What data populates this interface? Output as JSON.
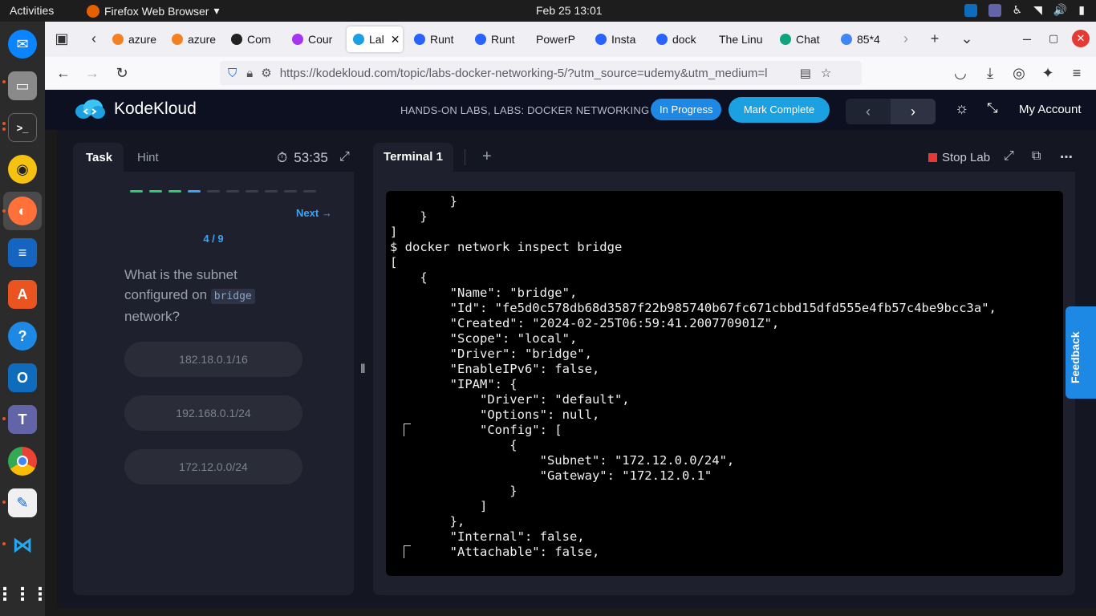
{
  "system": {
    "activities": "Activities",
    "app_name": "Firefox Web Browser",
    "clock": "Feb 25  13:01"
  },
  "browser": {
    "tabs": [
      {
        "label": "azure",
        "icon": "stackoverflow-icon",
        "color": "#f48024"
      },
      {
        "label": "azure",
        "icon": "stackoverflow-icon",
        "color": "#f48024"
      },
      {
        "label": "Com",
        "icon": "com-icon",
        "color": "#222222"
      },
      {
        "label": "Cour",
        "icon": "udemy-icon",
        "color": "#a435f0"
      },
      {
        "label": "Lal",
        "icon": "kodekloud-icon",
        "color": "#1ba1e2"
      },
      {
        "label": "Runt",
        "icon": "runtime-icon",
        "color": "#2962ff"
      },
      {
        "label": "Runt",
        "icon": "runtime-icon",
        "color": "#2962ff"
      },
      {
        "label": "PowerP",
        "icon": "",
        "color": ""
      },
      {
        "label": "Insta",
        "icon": "runtime-icon",
        "color": "#2962ff"
      },
      {
        "label": "dock",
        "icon": "runtime-icon",
        "color": "#2962ff"
      },
      {
        "label": "The Linu",
        "icon": "",
        "color": ""
      },
      {
        "label": "Chat",
        "icon": "chatgpt-icon",
        "color": "#10a37f"
      },
      {
        "label": "85*4",
        "icon": "google-icon",
        "color": "#4285f4"
      }
    ],
    "url": "https://kodekloud.com/topic/labs-docker-networking-5/?utm_source=udemy&utm_medium=l"
  },
  "header": {
    "logo_text": "KodeKloud",
    "breadcrumb": "HANDS-ON LABS, LABS: DOCKER NETWORKING",
    "status_pill": "In Progress",
    "complete_button": "Mark Complete",
    "account": "My Account"
  },
  "task": {
    "tab_task": "Task",
    "tab_hint": "Hint",
    "timer": "53:35",
    "next_label": "Next",
    "counter": "4 / 9",
    "progress_colors": [
      "#2ecc71",
      "#2ecc71",
      "#2ecc71",
      "#3ba4f5",
      "#3a3e4a",
      "#3a3e4a",
      "#3a3e4a",
      "#3a3e4a",
      "#3a3e4a",
      "#3a3e4a"
    ],
    "question_before": "What is the subnet configured on",
    "question_code": "bridge",
    "question_after": "network?",
    "options": [
      "182.18.0.1/16",
      "192.168.0.1/24",
      "172.12.0.0/24"
    ]
  },
  "terminal": {
    "tab": "Terminal 1",
    "stop_label": "Stop Lab",
    "lines": [
      "        }",
      "    }",
      "]",
      "$ docker network inspect bridge",
      "[",
      "    {",
      "        \"Name\": \"bridge\",",
      "        \"Id\": \"fe5d0c578db68d3587f22b985740b67fc671cbbd15dfd555e4fb57c4be9bcc3a\",",
      "        \"Created\": \"2024-02-25T06:59:41.200770901Z\",",
      "        \"Scope\": \"local\",",
      "        \"Driver\": \"bridge\",",
      "        \"EnableIPv6\": false,",
      "        \"IPAM\": {",
      "            \"Driver\": \"default\",",
      "            \"Options\": null,",
      "            \"Config\": [",
      "                {",
      "                    \"Subnet\": \"172.12.0.0/24\",",
      "                    \"Gateway\": \"172.12.0.1\"",
      "                }",
      "            ]",
      "        },",
      "        \"Internal\": false,",
      "        \"Attachable\": false,"
    ]
  },
  "feedback": "Feedback"
}
